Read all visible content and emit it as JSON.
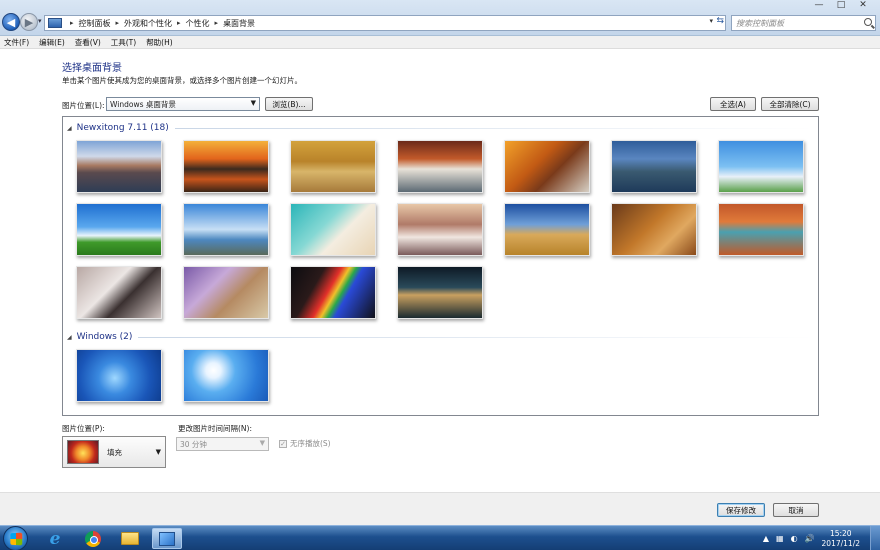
{
  "window": {
    "breadcrumb": [
      "控制面板",
      "外观和个性化",
      "个性化",
      "桌面背景"
    ],
    "search_placeholder": "搜索控制面板",
    "controls": {
      "minimize": "—",
      "maximize": "□",
      "close": "✕"
    }
  },
  "menu": [
    "文件(F)",
    "编辑(E)",
    "查看(V)",
    "工具(T)",
    "帮助(H)"
  ],
  "page": {
    "title": "选择桌面背景",
    "description": "单击某个图片使其成为您的桌面背景，或选择多个图片创建一个幻灯片。",
    "location_label": "图片位置(L):",
    "location_value": "Windows 桌面背景",
    "browse_label": "浏览(B)...",
    "select_all_label": "全选(A)",
    "clear_all_label": "全部清除(C)"
  },
  "groups": [
    {
      "name": "Newxitong 7.11 (18)",
      "thumbs": [
        {
          "name": "mountain-lake",
          "bg": "linear-gradient(180deg,#7ea4d6 0%,#cfd9e9 30%,#a87a62 48%,#5a4a4e 62%,#2e3d55 100%)"
        },
        {
          "name": "sunset-lake",
          "bg": "linear-gradient(180deg,#f4b13a 0%,#e2641c 35%,#3b2a1e 55%,#c7541c 75%,#3a2416 100%)"
        },
        {
          "name": "autumn-flood",
          "bg": "linear-gradient(180deg,#d3a23c 0%,#b9832a 40%,#d8b56a 60%,#a67a3a 100%)"
        },
        {
          "name": "waterfall",
          "bg": "linear-gradient(180deg,#6b2a1a 0%,#c25a2a 35%,#e8e2d8 55%,#5c6a74 100%)"
        },
        {
          "name": "autumn-fence",
          "bg": "linear-gradient(135deg,#f2a12a 0%,#c25a14 40%,#7a3a1a 60%,#d6cfc4 100%)"
        },
        {
          "name": "alpine-village",
          "bg": "linear-gradient(180deg,#2f5d9a 0%,#5a86c0 35%,#3a5a70 60%,#1e3a5a 100%)"
        },
        {
          "name": "flowers-sky",
          "bg": "linear-gradient(180deg,#3f8fe0 0%,#7cc0f2 50%,#e8f0f8 70%,#5aa04a 100%)"
        },
        {
          "name": "green-field",
          "bg": "linear-gradient(180deg,#1f6fd0 0%,#5aa8ee 45%,#e9f4fb 62%,#3f9a2a 75%,#2a7a1c 100%)"
        },
        {
          "name": "wind-turbine",
          "bg": "linear-gradient(180deg,#3a86d8 0%,#c7dff5 50%,#4d88c0 70%,#5a6a5a 100%)"
        },
        {
          "name": "aerial-beach",
          "bg": "linear-gradient(135deg,#2bb5b8 0%,#86d8d4 40%,#f4ede0 60%,#e8d4b4 100%)"
        },
        {
          "name": "rocky-sea",
          "bg": "linear-gradient(180deg,#e8c8a8 0%,#b07a68 40%,#f0e6e0 65%,#7a5a5a 100%)"
        },
        {
          "name": "hay-bale",
          "bg": "linear-gradient(180deg,#1d4fa0 0%,#6f9fd8 40%,#d9a95a 60%,#b7832a 100%)"
        },
        {
          "name": "desert-pyramid",
          "bg": "linear-gradient(135deg,#6a3a1a 0%,#c2782a 45%,#e0a860 70%,#8a4a1a 100%)"
        },
        {
          "name": "red-canyon",
          "bg": "linear-gradient(180deg,#c2582a 0%,#e07a3a 35%,#4aa0b0 55%,#c05a2a 100%)"
        },
        {
          "name": "girl-portrait",
          "bg": "linear-gradient(135deg,#b8a8a4 0%,#ece6e4 40%,#3a3030 60%,#cfc3c0 100%)"
        },
        {
          "name": "hand-fence",
          "bg": "linear-gradient(135deg,#7a5aa8 0%,#c7a9d8 35%,#b58a62 60%,#d8c9a8 100%)"
        },
        {
          "name": "rainbow-street",
          "bg": "linear-gradient(120deg,#0c0c10 0%,#2a1a1a 30%,#e2302a 45%,#f0c02a 52%,#2aa84a 58%,#2a4ad8 64%,#101018 100%)"
        },
        {
          "name": "city-night",
          "bg": "linear-gradient(180deg,#0e1a26 0%,#2a4a5a 40%,#c8a060 55%,#1a2a30 100%)"
        }
      ]
    },
    {
      "name": "Windows (2)",
      "thumbs": [
        {
          "name": "windows7-logo",
          "bg": "radial-gradient(circle at 45% 55%,#9fd8ff 0%,#3a8ae0 30%,#1a56b8 65%,#0d3a8a 100%)"
        },
        {
          "name": "daisy",
          "bg": "radial-gradient(circle at 35% 40%,#ffffff 0%,#e8f4ff 12%,#5aaef0 35%,#2a7ad8 70%,#1a5ab8 100%)"
        }
      ]
    }
  ],
  "bottom": {
    "position_label": "图片位置(P):",
    "position_value": "填充",
    "interval_label": "更改图片时间间隔(N):",
    "interval_value": "30 分钟",
    "shuffle_label": "无序播放(S)",
    "shuffle_check": "✓"
  },
  "footer": {
    "save_label": "保存修改",
    "cancel_label": "取消"
  },
  "taskbar": {
    "ie": "e",
    "time": "15:20",
    "date": "2017/11/2",
    "tray": [
      "▲",
      "▦",
      "◐",
      "🔊"
    ]
  }
}
